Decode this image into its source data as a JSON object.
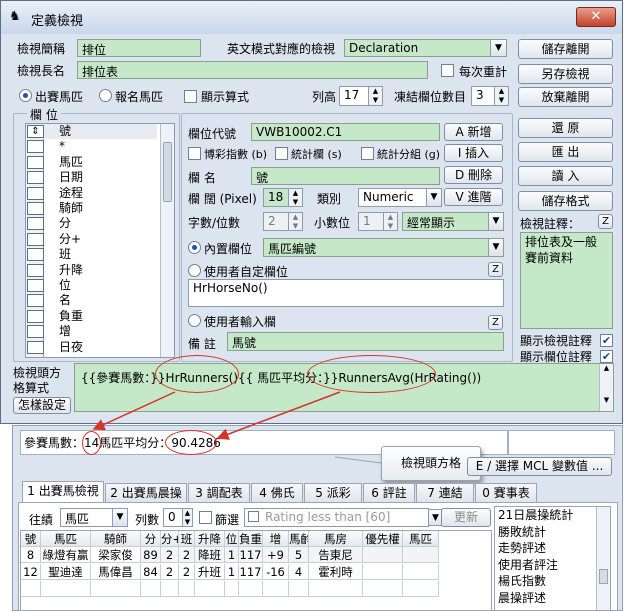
{
  "window": {
    "title": "定義檢視",
    "close_glyph": "✕"
  },
  "view_code": {
    "label": "檢視簡稱",
    "value": "排位"
  },
  "english_mode": {
    "label": "英文模式對應的檢視",
    "value": "Declaration"
  },
  "view_long": {
    "label": "檢視長名",
    "value": "排位表"
  },
  "reset_each": {
    "label": "每次重計"
  },
  "horse_mode": {
    "opt1": "出賽馬匹",
    "opt2": "報名馬匹",
    "show_formula": "顯示算式"
  },
  "columns_count": {
    "label": "列高",
    "value": "17"
  },
  "freeze": {
    "label": "凍結欄位數目",
    "value": "3"
  },
  "right_buttons": {
    "save_leave": "儲存離開",
    "save_as": "另存檢視",
    "discard": "放棄離開",
    "restore": "還 原",
    "export": "匯 出",
    "import": "讀 入",
    "save_format": "儲存格式"
  },
  "columns_group": {
    "title": "欄 位",
    "items": [
      "號",
      "*",
      "馬匹",
      "日期",
      "途程",
      "騎師",
      "分",
      "分+",
      "班",
      "升降",
      "位",
      "名",
      "負重",
      "增",
      "日夜"
    ]
  },
  "detail": {
    "code_label": "欄位代號",
    "code_value": "VWB10002.C1",
    "pct_label": "博彩指數 (b)",
    "stat_label": "統計欄 (s)",
    "stat_group_label": "統計分組 (g)",
    "name_label": "欄 名",
    "name_value": "號",
    "width_label": "欄 闊 (Pixel)",
    "width_value": "18",
    "type_label": "類別",
    "type_value": "Numeric",
    "digits_label": "字數/位數",
    "digits_value": "2",
    "decimal_label": "小數位",
    "decimal_value": "1",
    "display_value": "經常顯示",
    "builtin_label": "內置欄位",
    "builtin_value": "馬匹編號",
    "user_def_label": "使用者自定欄位",
    "user_def_value": "HrHorseNo()",
    "user_input_label": "使用者輸入欄",
    "remark_label": "備 註",
    "remark_value": "馬號",
    "btn_add": "A 新增",
    "btn_insert": "I 插入",
    "btn_delete": "D 刪除",
    "btn_advance": "V 進階",
    "z_label": "Z"
  },
  "view_comment": {
    "label": "檢視註釋：",
    "value": "排位表及一般賽前資料",
    "show_view_comment": "顯示檢視註釋",
    "show_col_comment": "顯示欄位註釋"
  },
  "header_format": {
    "label": "檢視頭方格算式",
    "value": "{{參賽馬數：}}HrRunners(){{ 馬匹平均分：}}RunnersAvg(HrRating())",
    "howto": "怎樣設定"
  },
  "result_line": {
    "prefix": "參賽馬數：",
    "runners": "14",
    "mid": "馬匹平均分：",
    "avg": "90.4286"
  },
  "callout": {
    "text": "檢視頭方格"
  },
  "mcl_button": {
    "label": "E / 選擇 MCL 變數值 ..."
  },
  "tabs": [
    "1 出賽馬檢視",
    "2 出賽馬晨操",
    "3 調配表",
    "4 佛氏",
    "5 派彩",
    "6 評註",
    "7 連結",
    "0 賽事表"
  ],
  "filter_bar": {
    "goto_label": "往績",
    "horse_value": "馬匹",
    "rows_label": "列數",
    "rows_value": "0",
    "filter_label": "篩選",
    "rating_placeholder": "Rating less than [60]",
    "update": "更新"
  },
  "grid": {
    "headers": [
      "號",
      "馬匹",
      "騎師",
      "分",
      "分+",
      "班",
      "升降",
      "位",
      "負重",
      "增",
      "馬齡",
      "馬房",
      "優先權",
      "馬匹"
    ],
    "rows": [
      [
        "8",
        "綠燈有贏",
        "梁家俊",
        "89",
        "2",
        "2",
        "降班",
        "1",
        "117",
        "+9",
        "5",
        "告東尼",
        "",
        ""
      ],
      [
        "12",
        "聖迪達",
        "馬偉昌",
        "84",
        "2",
        "2",
        "升班",
        "1",
        "117",
        "-16",
        "4",
        "霍利時",
        "",
        ""
      ],
      [
        "",
        "",
        "",
        "",
        "",
        "",
        "",
        "",
        "",
        "",
        "",
        "",
        "",
        ""
      ]
    ]
  },
  "side_list": {
    "items": [
      "21日晨操統計",
      "勝敗統計",
      "走勢評述",
      "使用者評注",
      "楊氏指數",
      "晨操評述"
    ]
  }
}
